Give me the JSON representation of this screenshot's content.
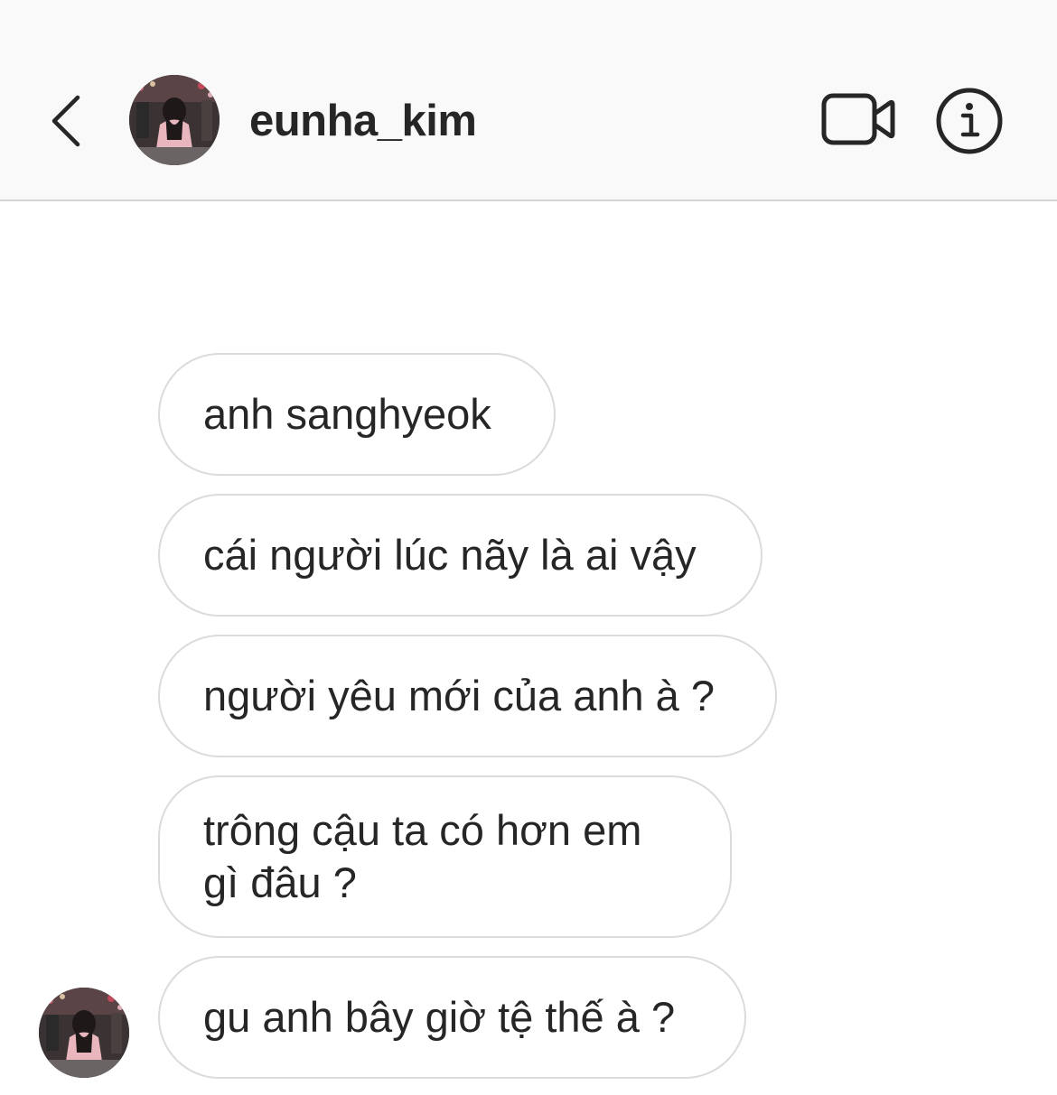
{
  "header": {
    "username": "eunha_kim",
    "back_icon": "chevron-left-icon",
    "video_icon": "video-camera-icon",
    "info_icon": "info-circle-icon"
  },
  "messages": [
    {
      "text": "anh sanghyeok"
    },
    {
      "text": "cái người lúc nãy là ai vậy"
    },
    {
      "text": "người yêu mới của anh à ?"
    },
    {
      "text": "trông cậu ta có hơn em\ngì đâu ?"
    },
    {
      "text": "gu anh bây giờ tệ thế à ?"
    }
  ],
  "colors": {
    "header_bg": "#f9f9f9",
    "bubble_border": "#dbdbdb",
    "text": "#262626"
  }
}
